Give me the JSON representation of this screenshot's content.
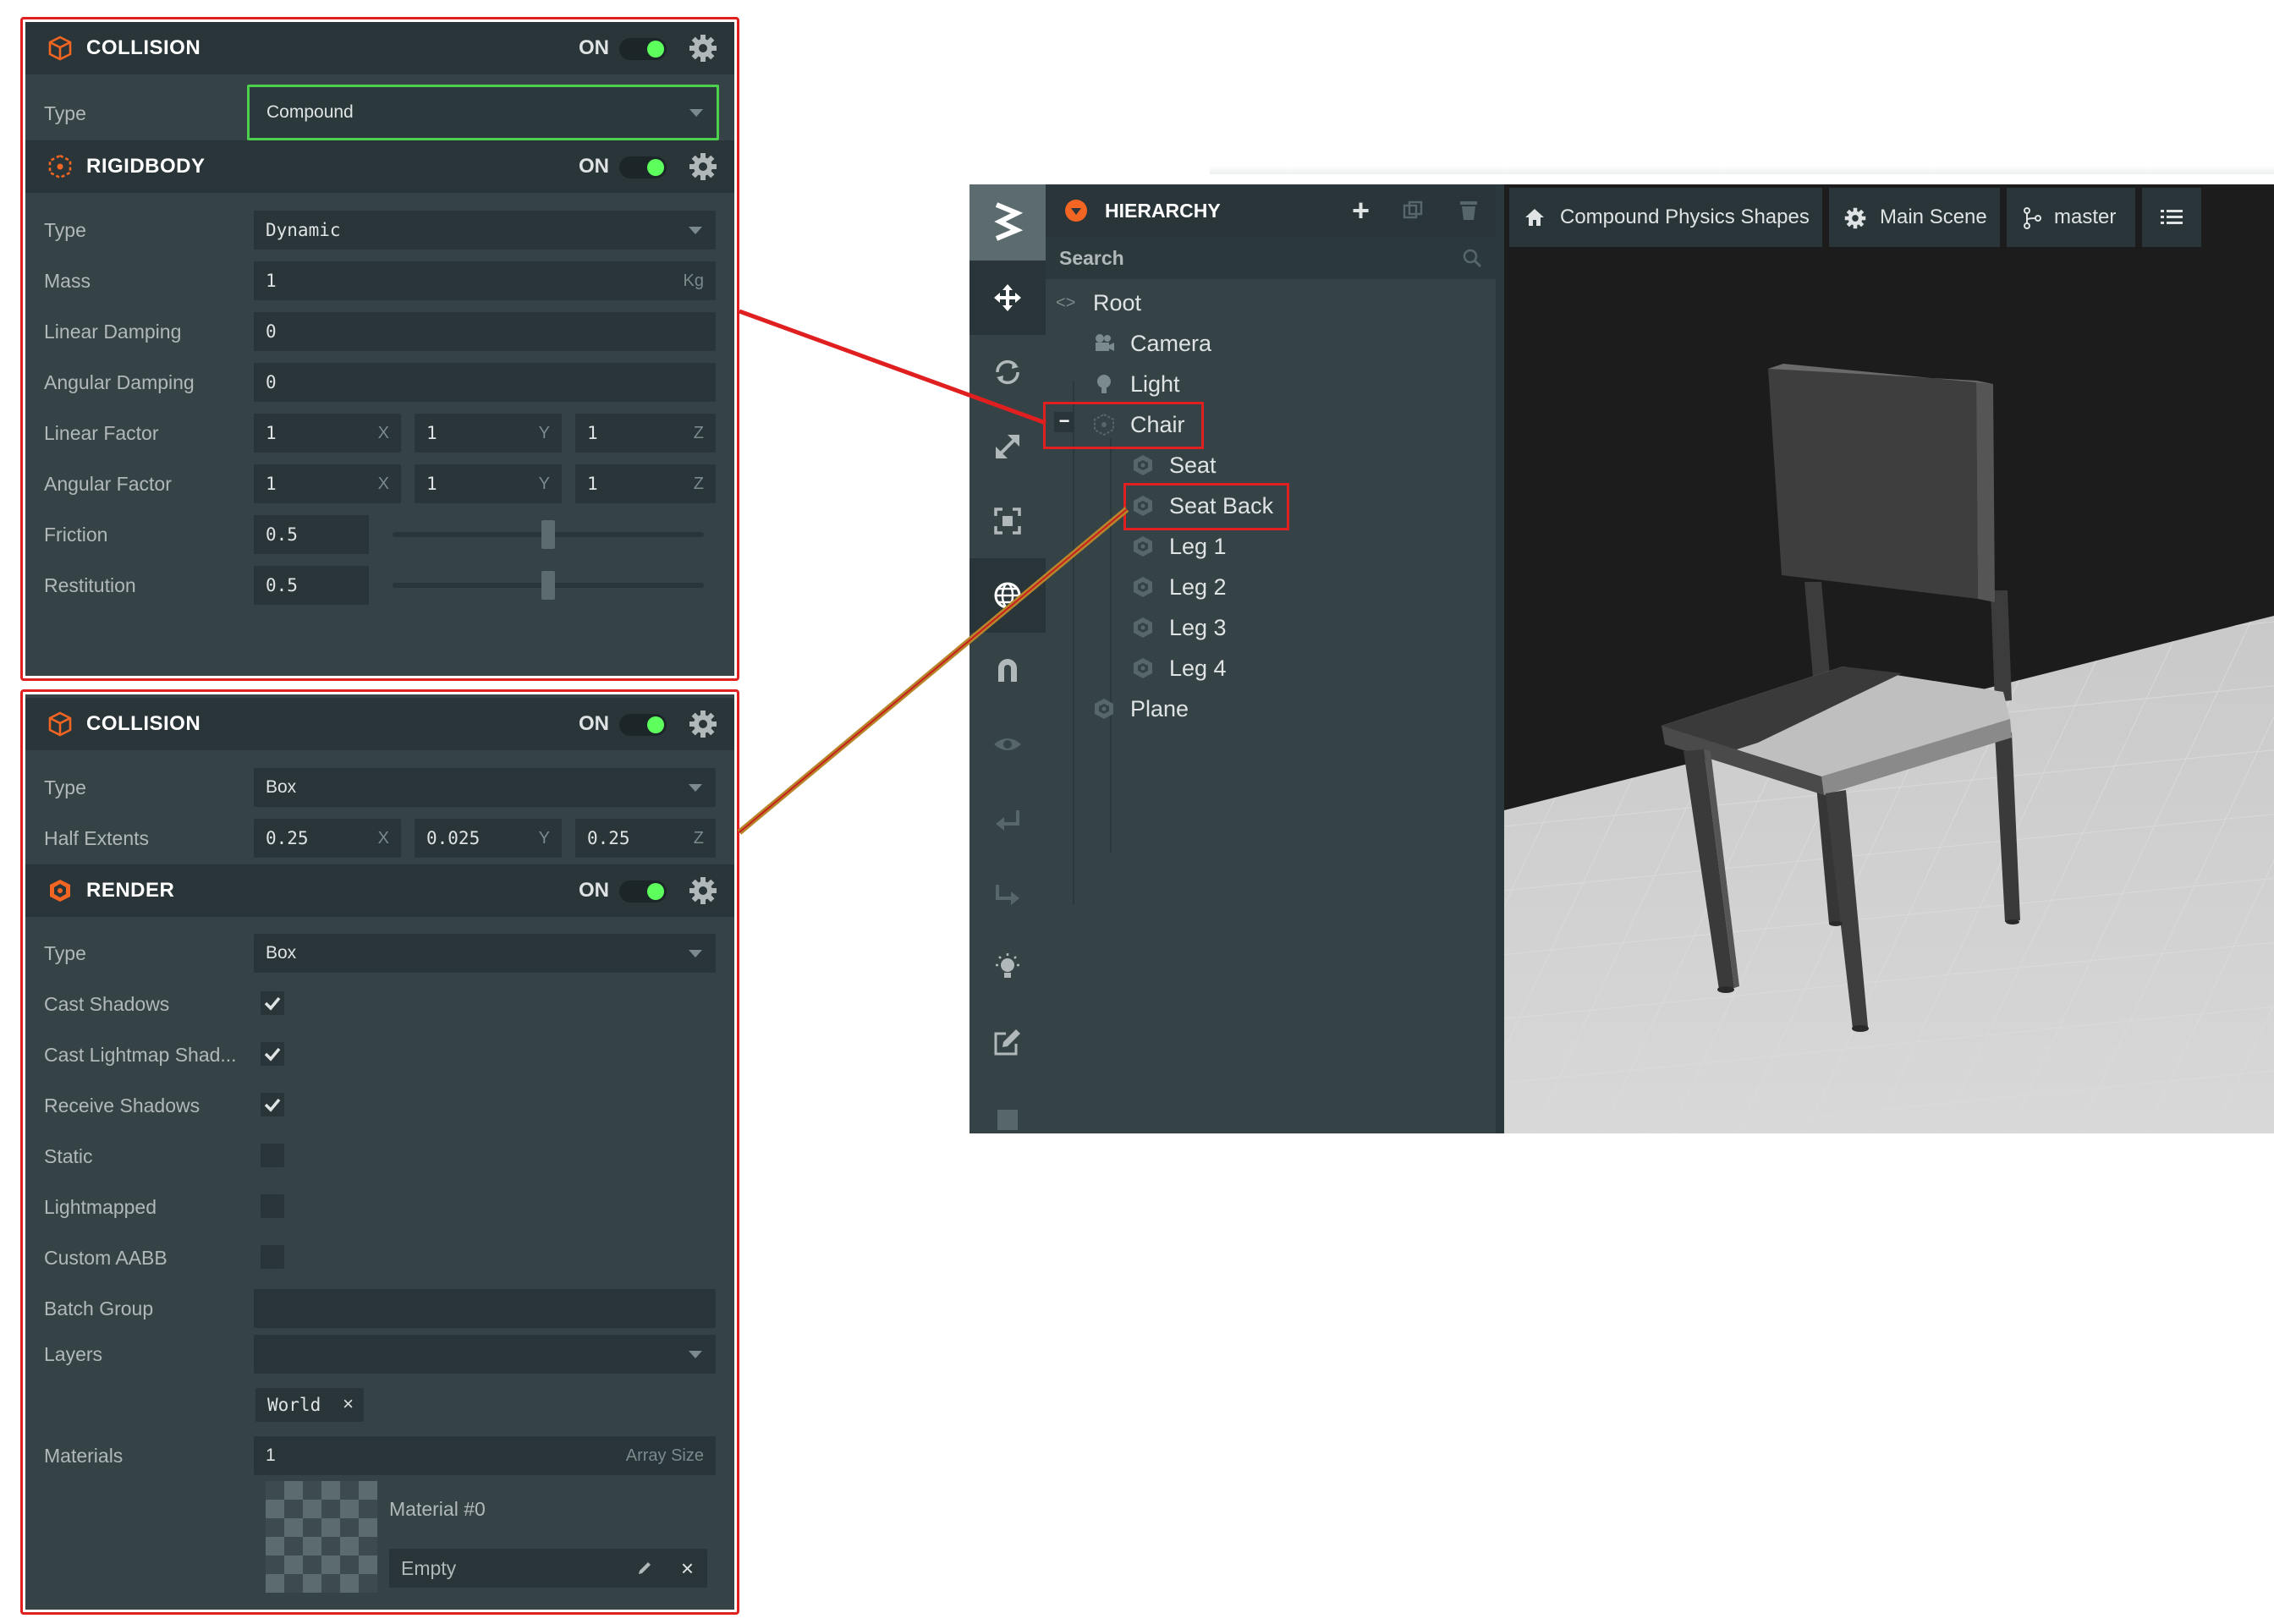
{
  "panel_top": {
    "collision": {
      "title": "COLLISION",
      "on_label": "ON",
      "type_label": "Type",
      "type_value": "Compound"
    },
    "rigidbody": {
      "title": "RIGIDBODY",
      "on_label": "ON",
      "type_label": "Type",
      "type_value": "Dynamic",
      "mass_label": "Mass",
      "mass_value": "1",
      "mass_unit": "Kg",
      "linear_damping_label": "Linear Damping",
      "linear_damping_value": "0",
      "angular_damping_label": "Angular Damping",
      "angular_damping_value": "0",
      "linear_factor_label": "Linear Factor",
      "linear_factor": [
        "1",
        "1",
        "1"
      ],
      "angular_factor_label": "Angular Factor",
      "angular_factor": [
        "1",
        "1",
        "1"
      ],
      "axis_labels": [
        "X",
        "Y",
        "Z"
      ],
      "friction_label": "Friction",
      "friction_value": "0.5",
      "friction_slider": 0.5,
      "restitution_label": "Restitution",
      "restitution_value": "0.5",
      "restitution_slider": 0.5
    }
  },
  "panel_bottom": {
    "collision": {
      "title": "COLLISION",
      "on_label": "ON",
      "type_label": "Type",
      "type_value": "Box",
      "half_extents_label": "Half Extents",
      "half_extents": [
        "0.25",
        "0.025",
        "0.25"
      ],
      "axis_labels": [
        "X",
        "Y",
        "Z"
      ]
    },
    "render": {
      "title": "RENDER",
      "on_label": "ON",
      "type_label": "Type",
      "type_value": "Box",
      "cast_shadows_label": "Cast Shadows",
      "cast_shadows": true,
      "cast_lightmap_label": "Cast Lightmap Shad...",
      "cast_lightmap": true,
      "receive_shadows_label": "Receive Shadows",
      "receive_shadows": true,
      "static_label": "Static",
      "static": false,
      "lightmapped_label": "Lightmapped",
      "lightmapped": false,
      "custom_aabb_label": "Custom AABB",
      "custom_aabb": false,
      "batch_group_label": "Batch Group",
      "layers_label": "Layers",
      "layer_tag": "World",
      "materials_label": "Materials",
      "materials_count": "1",
      "array_size_label": "Array Size",
      "material_name": "Material #0",
      "material_slot": "Empty"
    }
  },
  "hierarchy": {
    "title": "HIERARCHY",
    "search_placeholder": "Search",
    "items": [
      {
        "label": "Root"
      },
      {
        "label": "Camera"
      },
      {
        "label": "Light"
      },
      {
        "label": "Chair"
      },
      {
        "label": "Seat"
      },
      {
        "label": "Seat Back"
      },
      {
        "label": "Leg 1"
      },
      {
        "label": "Leg 2"
      },
      {
        "label": "Leg 3"
      },
      {
        "label": "Leg 4"
      },
      {
        "label": "Plane"
      }
    ]
  },
  "viewport": {
    "tabs": {
      "project": "Compound Physics Shapes",
      "scene": "Main Scene",
      "branch": "master"
    }
  },
  "colors": {
    "accent_orange": "#f26522",
    "toggle_green": "#5dff5d",
    "highlight_red": "#e02020",
    "selection_green": "#4dd04d"
  }
}
